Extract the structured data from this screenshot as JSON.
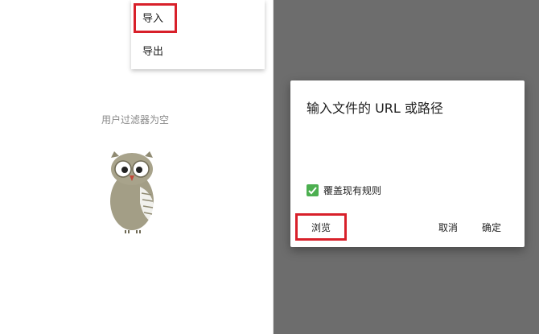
{
  "menu": {
    "import_label": "导入",
    "export_label": "导出"
  },
  "empty_state": {
    "text": "用户过滤器为空",
    "illustration": "owl-illustration"
  },
  "dialog": {
    "title": "输入文件的 URL 或路径",
    "checkbox_label": "覆盖现有规则",
    "checkbox_checked": true,
    "browse_label": "浏览",
    "cancel_label": "取消",
    "ok_label": "确定"
  },
  "colors": {
    "highlight": "#d8202a",
    "checkbox": "#4caf50",
    "overlay": "#6d6d6d"
  }
}
